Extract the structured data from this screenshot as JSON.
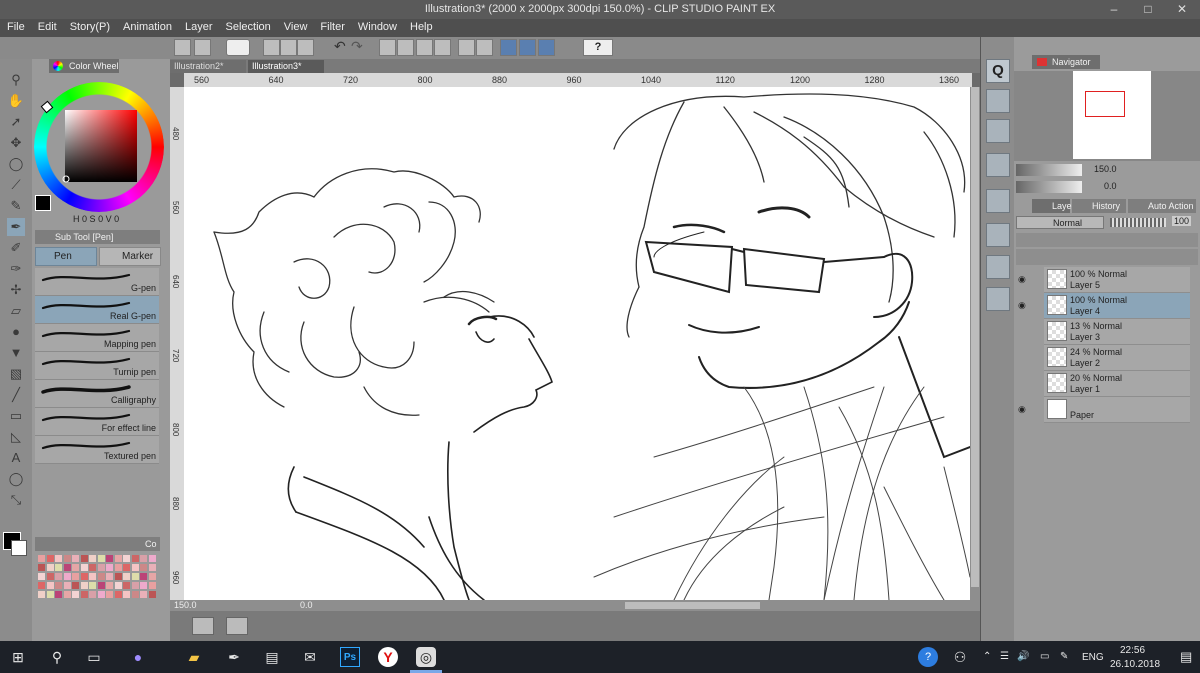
{
  "app": {
    "title": "Illustration3* (2000 x 2000px 300dpi 150.0%) - CLIP STUDIO PAINT EX",
    "window_buttons": [
      "–",
      "□",
      "✕"
    ]
  },
  "menu": [
    "File",
    "Edit",
    "Story(P)",
    "Animation",
    "Layer",
    "Selection",
    "View",
    "Filter",
    "Window",
    "Help"
  ],
  "documents": {
    "tabs": [
      "Illustration2*",
      "Illustration3*"
    ],
    "active_index": 1
  },
  "ruler": {
    "h_ticks": [
      "560",
      "640",
      "720",
      "800",
      "880",
      "960",
      "1040",
      "1120",
      "1200",
      "1280",
      "1360"
    ],
    "v_ticks": [
      "480",
      "560",
      "640",
      "720",
      "800",
      "880",
      "960"
    ]
  },
  "color_wheel": {
    "tab_label": "Color Wheel",
    "readout": [
      "H",
      "0",
      "S",
      "0",
      "V",
      "0"
    ],
    "current_color": "#000000",
    "hue": "#ff0000"
  },
  "sub_tool": {
    "tab_label": "Sub Tool [Pen]",
    "groups": [
      "Pen",
      "Marker"
    ],
    "brushes": [
      {
        "name": "G-pen",
        "selected": false
      },
      {
        "name": "Real G-pen",
        "selected": true
      },
      {
        "name": "Mapping pen",
        "selected": false
      },
      {
        "name": "Turnip pen",
        "selected": false
      },
      {
        "name": "Calligraphy",
        "selected": false
      },
      {
        "name": "For effect line",
        "selected": false
      },
      {
        "name": "Textured pen",
        "selected": false
      }
    ]
  },
  "color_set": {
    "tab_label": "Co"
  },
  "status": {
    "zoom": "150.0",
    "rotation": "0.0"
  },
  "navigator": {
    "tab_label": "Navigator",
    "zoom": "150.0",
    "rotation": "0.0"
  },
  "layer_panel": {
    "tabs": [
      "Layer",
      "History",
      "Auto Action"
    ],
    "blend_mode": "Normal",
    "opacity": "100",
    "layers": [
      {
        "line1": "100 % Normal",
        "line2": "Layer 5",
        "visible": true,
        "selected": false
      },
      {
        "line1": "100 % Normal",
        "line2": "Layer 4",
        "visible": true,
        "selected": true
      },
      {
        "line1": "13 % Normal",
        "line2": "Layer 3",
        "visible": false,
        "selected": false
      },
      {
        "line1": "24 % Normal",
        "line2": "Layer 2",
        "visible": false,
        "selected": false
      },
      {
        "line1": "20 % Normal",
        "line2": "Layer 1",
        "visible": false,
        "selected": false
      },
      {
        "line1": "",
        "line2": "Paper",
        "visible": true,
        "selected": false
      }
    ]
  },
  "taskbar": {
    "language": "ENG",
    "time": "22:56",
    "date": "26.10.2018",
    "accent": "#1d2128"
  }
}
